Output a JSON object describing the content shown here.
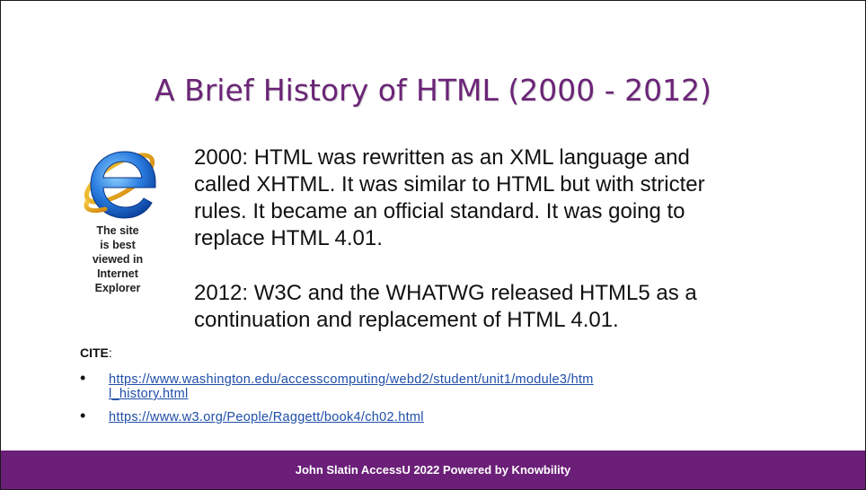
{
  "slide": {
    "title": "A Brief History of HTML (2000 - 2012)",
    "image_caption_lines": [
      "The site",
      "is best",
      "viewed in",
      "Internet",
      "Explorer"
    ],
    "paragraphs": [
      {
        "lines": [
          "2000: HTML was rewritten as an XML language and",
          "called XHTML.  It was similar to HTML but with stricter",
          "rules.  It became an official standard. It was going to",
          "replace HTML 4.01."
        ]
      },
      {
        "lines": [
          "2012: W3C and the WHATWG released HTML5 as a",
          "continuation and replacement of HTML 4.01."
        ]
      }
    ],
    "cite_label": "CITE",
    "cite_suffix": ":",
    "links": [
      {
        "lines": [
          "https://www.washington.edu/accesscomputing/webd2/student/unit1/module3/htm",
          "l_history.html"
        ]
      },
      {
        "lines": [
          "https://www.w3.org/People/Raggett/book4/ch02.html"
        ]
      }
    ],
    "footer": "John Slatin AccessU 2022 Powered by Knowbility"
  },
  "colors": {
    "title": "#6b2477",
    "footer_bg": "#6b1f78",
    "link": "#1f4ea8"
  },
  "icons": {
    "ie_logo": "internet-explorer-logo-icon"
  }
}
